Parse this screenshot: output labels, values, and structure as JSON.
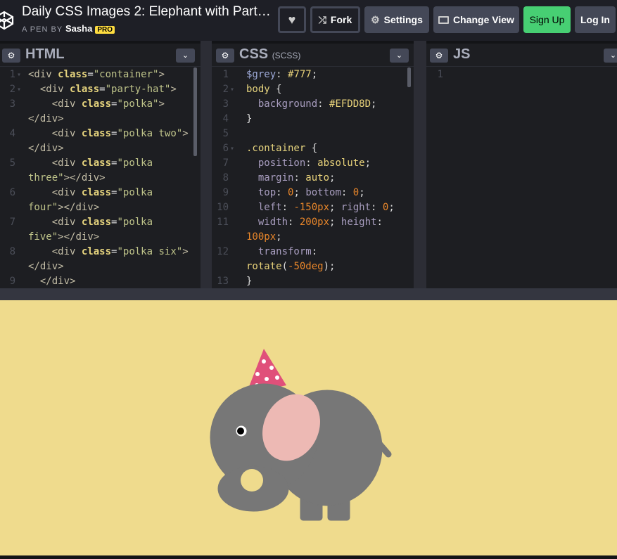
{
  "header": {
    "title": "Daily CSS Images 2: Elephant with Part…",
    "byline_prefix": "A PEN BY",
    "author": "Sasha",
    "badge": "PRO",
    "buttons": {
      "heart": "heart-icon",
      "fork": "Fork",
      "settings": "Settings",
      "change_view": "Change View",
      "sign_up": "Sign Up",
      "log_in": "Log In"
    }
  },
  "panes": {
    "html": {
      "label": "HTML",
      "rows": [
        {
          "n": "1",
          "f": true,
          "t": [
            [
              "tag",
              "<div "
            ],
            [
              "attr",
              "class"
            ],
            [
              "p",
              "="
            ],
            [
              "str",
              "\"container\""
            ],
            [
              "tag",
              ">"
            ]
          ]
        },
        {
          "n": "2",
          "f": true,
          "t": [
            [
              "p",
              "  "
            ],
            [
              "tag",
              "<div "
            ],
            [
              "attr",
              "class"
            ],
            [
              "p",
              "="
            ],
            [
              "str",
              "\"party-hat\""
            ],
            [
              "tag",
              ">"
            ]
          ]
        },
        {
          "n": "3",
          "t": [
            [
              "p",
              "    "
            ],
            [
              "tag",
              "<div "
            ],
            [
              "attr",
              "class"
            ],
            [
              "p",
              "="
            ],
            [
              "str",
              "\"polka\""
            ],
            [
              "tag",
              ">"
            ]
          ]
        },
        {
          "n": "",
          "t": [
            [
              "tag",
              "</div>"
            ]
          ]
        },
        {
          "n": "4",
          "t": [
            [
              "p",
              "    "
            ],
            [
              "tag",
              "<div "
            ],
            [
              "attr",
              "class"
            ],
            [
              "p",
              "="
            ],
            [
              "str",
              "\"polka two\""
            ],
            [
              "tag",
              ">"
            ]
          ]
        },
        {
          "n": "",
          "t": [
            [
              "tag",
              "</div>"
            ]
          ]
        },
        {
          "n": "5",
          "t": [
            [
              "p",
              "    "
            ],
            [
              "tag",
              "<div "
            ],
            [
              "attr",
              "class"
            ],
            [
              "p",
              "="
            ],
            [
              "str",
              "\"polka"
            ]
          ]
        },
        {
          "n": "",
          "t": [
            [
              "str",
              "three\""
            ],
            [
              "tag",
              "></div>"
            ]
          ]
        },
        {
          "n": "6",
          "t": [
            [
              "p",
              "    "
            ],
            [
              "tag",
              "<div "
            ],
            [
              "attr",
              "class"
            ],
            [
              "p",
              "="
            ],
            [
              "str",
              "\"polka"
            ]
          ]
        },
        {
          "n": "",
          "t": [
            [
              "str",
              "four\""
            ],
            [
              "tag",
              "></div>"
            ]
          ]
        },
        {
          "n": "7",
          "t": [
            [
              "p",
              "    "
            ],
            [
              "tag",
              "<div "
            ],
            [
              "attr",
              "class"
            ],
            [
              "p",
              "="
            ],
            [
              "str",
              "\"polka"
            ]
          ]
        },
        {
          "n": "",
          "t": [
            [
              "str",
              "five\""
            ],
            [
              "tag",
              "></div>"
            ]
          ]
        },
        {
          "n": "8",
          "t": [
            [
              "p",
              "    "
            ],
            [
              "tag",
              "<div "
            ],
            [
              "attr",
              "class"
            ],
            [
              "p",
              "="
            ],
            [
              "str",
              "\"polka six\""
            ],
            [
              "tag",
              ">"
            ]
          ]
        },
        {
          "n": "",
          "t": [
            [
              "tag",
              "</div>"
            ]
          ]
        },
        {
          "n": "9",
          "t": [
            [
              "p",
              "  "
            ],
            [
              "tag",
              "</div>"
            ]
          ]
        }
      ]
    },
    "css": {
      "label": "CSS",
      "sublabel": "(SCSS)",
      "rows": [
        {
          "n": "1",
          "t": [
            [
              "var",
              "$grey"
            ],
            [
              "p",
              ": "
            ],
            [
              "val",
              "#777"
            ],
            [
              "p",
              ";"
            ]
          ]
        },
        {
          "n": "2",
          "f": true,
          "t": [
            [
              "sel",
              "body"
            ],
            [
              "p",
              " {"
            ]
          ]
        },
        {
          "n": "3",
          "t": [
            [
              "p",
              "  "
            ],
            [
              "prop",
              "background"
            ],
            [
              "p",
              ": "
            ],
            [
              "val",
              "#EFDD8D"
            ],
            [
              "p",
              ";"
            ]
          ]
        },
        {
          "n": "4",
          "t": [
            [
              "p",
              "}"
            ]
          ]
        },
        {
          "n": "5",
          "t": []
        },
        {
          "n": "6",
          "f": true,
          "t": [
            [
              "sel",
              ".container"
            ],
            [
              "p",
              " {"
            ]
          ]
        },
        {
          "n": "7",
          "t": [
            [
              "p",
              "  "
            ],
            [
              "prop",
              "position"
            ],
            [
              "p",
              ": "
            ],
            [
              "val",
              "absolute"
            ],
            [
              "p",
              ";"
            ]
          ]
        },
        {
          "n": "8",
          "t": [
            [
              "p",
              "  "
            ],
            [
              "prop",
              "margin"
            ],
            [
              "p",
              ": "
            ],
            [
              "val",
              "auto"
            ],
            [
              "p",
              ";"
            ]
          ]
        },
        {
          "n": "9",
          "t": [
            [
              "p",
              "  "
            ],
            [
              "prop",
              "top"
            ],
            [
              "p",
              ": "
            ],
            [
              "num",
              "0"
            ],
            [
              "p",
              "; "
            ],
            [
              "prop",
              "bottom"
            ],
            [
              "p",
              ": "
            ],
            [
              "num",
              "0"
            ],
            [
              "p",
              ";"
            ]
          ]
        },
        {
          "n": "10",
          "t": [
            [
              "p",
              "  "
            ],
            [
              "prop",
              "left"
            ],
            [
              "p",
              ": "
            ],
            [
              "num",
              "-150px"
            ],
            [
              "p",
              "; "
            ],
            [
              "prop",
              "right"
            ],
            [
              "p",
              ": "
            ],
            [
              "num",
              "0"
            ],
            [
              "p",
              ";"
            ]
          ]
        },
        {
          "n": "11",
          "t": [
            [
              "p",
              "  "
            ],
            [
              "prop",
              "width"
            ],
            [
              "p",
              ": "
            ],
            [
              "num",
              "200px"
            ],
            [
              "p",
              "; "
            ],
            [
              "prop",
              "height"
            ],
            [
              "p",
              ":"
            ]
          ]
        },
        {
          "n": "",
          "t": [
            [
              "num",
              "100px"
            ],
            [
              "p",
              ";"
            ]
          ]
        },
        {
          "n": "12",
          "t": [
            [
              "p",
              "  "
            ],
            [
              "prop",
              "transform"
            ],
            [
              "p",
              ":"
            ]
          ]
        },
        {
          "n": "",
          "t": [
            [
              "val",
              "rotate"
            ],
            [
              "p",
              "("
            ],
            [
              "num",
              "-50deg"
            ],
            [
              "p",
              ");"
            ]
          ]
        },
        {
          "n": "13",
          "t": [
            [
              "p",
              "}"
            ]
          ]
        }
      ]
    },
    "js": {
      "label": "JS",
      "rows": [
        {
          "n": "1",
          "t": []
        }
      ]
    }
  },
  "preview": {
    "background": "#EFDB8D",
    "elephant": "#777777",
    "ear": "#EDB9B4",
    "hat": "#E0507A"
  }
}
